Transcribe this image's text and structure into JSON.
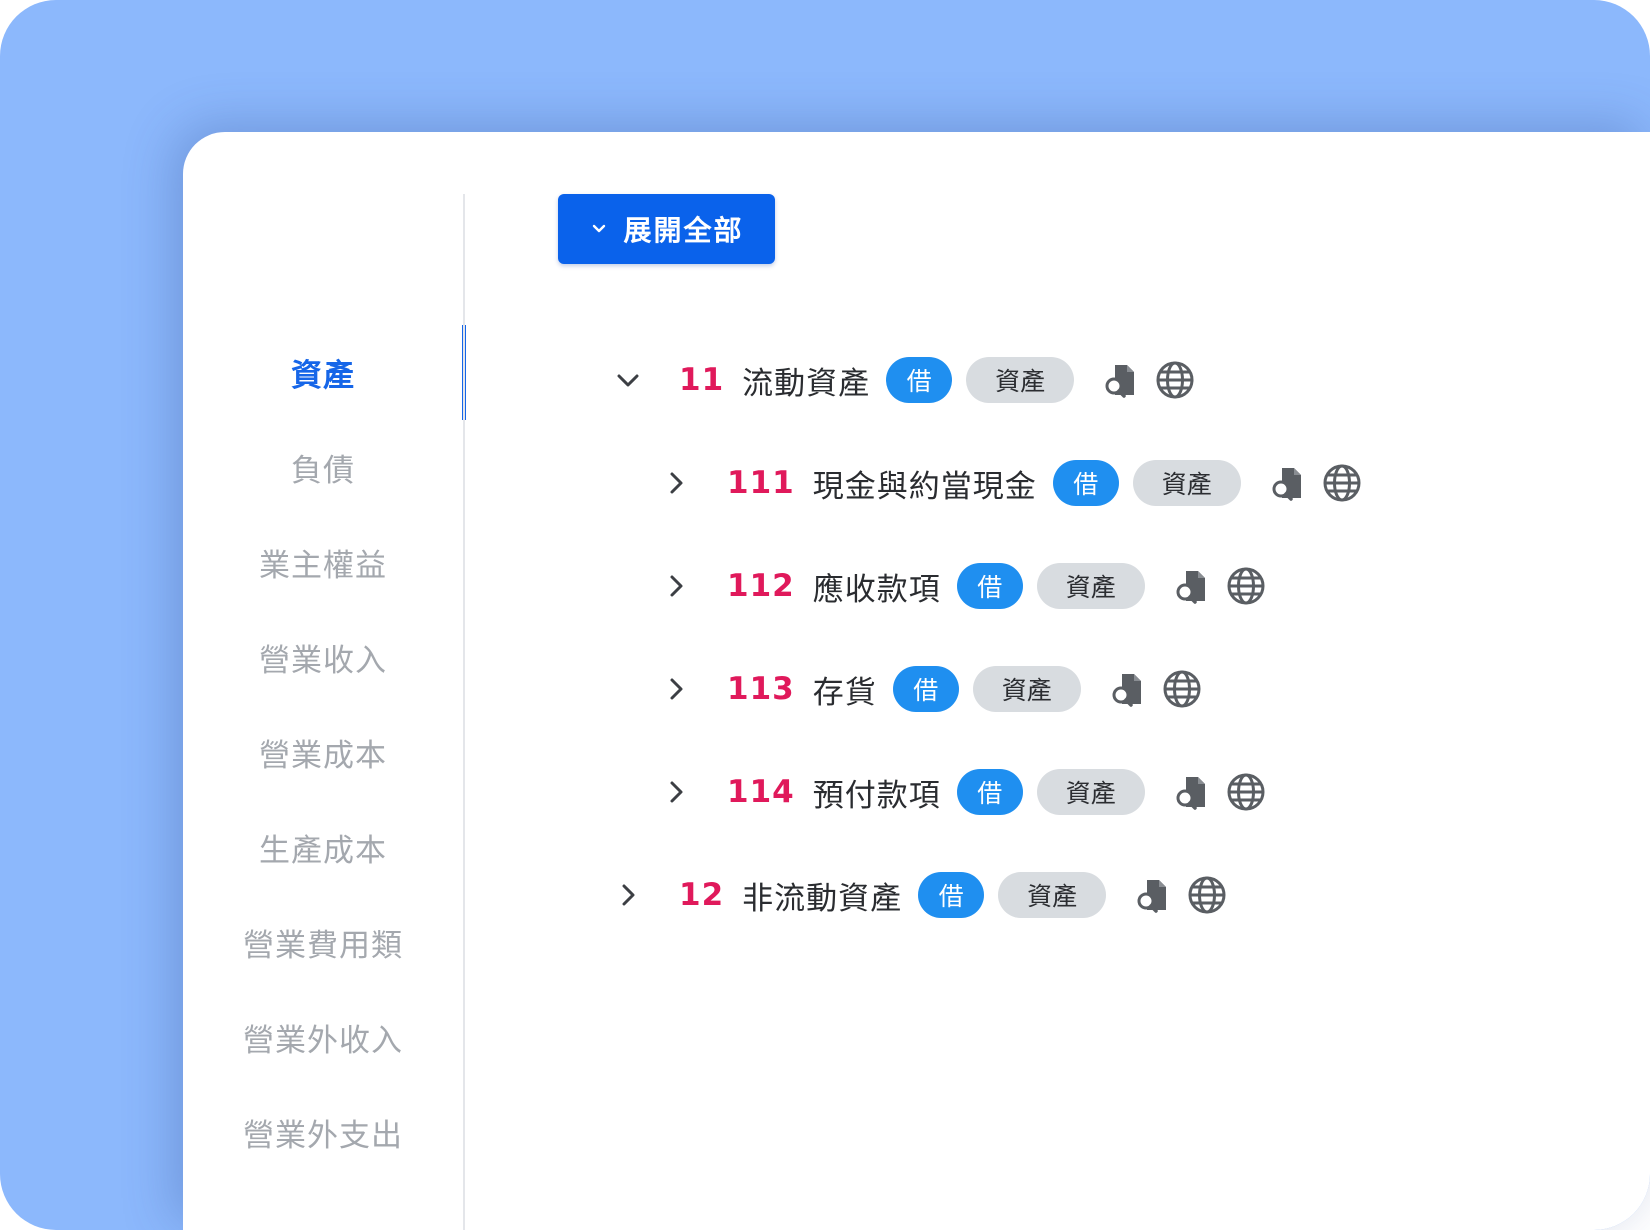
{
  "colors": {
    "backdrop": "#8cb8fc",
    "accent": "#1666e8",
    "code": "#e0195b",
    "debit_pill": "#1f8ff0",
    "category_pill": "#d8dce0"
  },
  "sidebar": {
    "items": [
      {
        "label": "資產",
        "active": true
      },
      {
        "label": "負債"
      },
      {
        "label": "業主權益"
      },
      {
        "label": "營業收入"
      },
      {
        "label": "營業成本"
      },
      {
        "label": "生產成本"
      },
      {
        "label": "營業費用類"
      },
      {
        "label": "營業外收入"
      },
      {
        "label": "營業外支出"
      }
    ]
  },
  "toolbar": {
    "expand_all_label": "展開全部",
    "expand_icon": "chevron-down-icon"
  },
  "tree": [
    {
      "code": "11",
      "name": "流動資產",
      "direction": "借",
      "category": "資產",
      "expanded": true,
      "level": 0
    },
    {
      "code": "111",
      "name": "現金與約當現金",
      "direction": "借",
      "category": "資產",
      "expanded": false,
      "level": 1
    },
    {
      "code": "112",
      "name": "應收款項",
      "direction": "借",
      "category": "資產",
      "expanded": false,
      "level": 1
    },
    {
      "code": "113",
      "name": "存貨",
      "direction": "借",
      "category": "資產",
      "expanded": false,
      "level": 1
    },
    {
      "code": "114",
      "name": "預付款項",
      "direction": "借",
      "category": "資產",
      "expanded": false,
      "level": 1
    },
    {
      "code": "12",
      "name": "非流動資產",
      "direction": "借",
      "category": "資產",
      "expanded": false,
      "level": 0
    }
  ],
  "row_icons": [
    "document-search-icon",
    "globe-icon"
  ]
}
